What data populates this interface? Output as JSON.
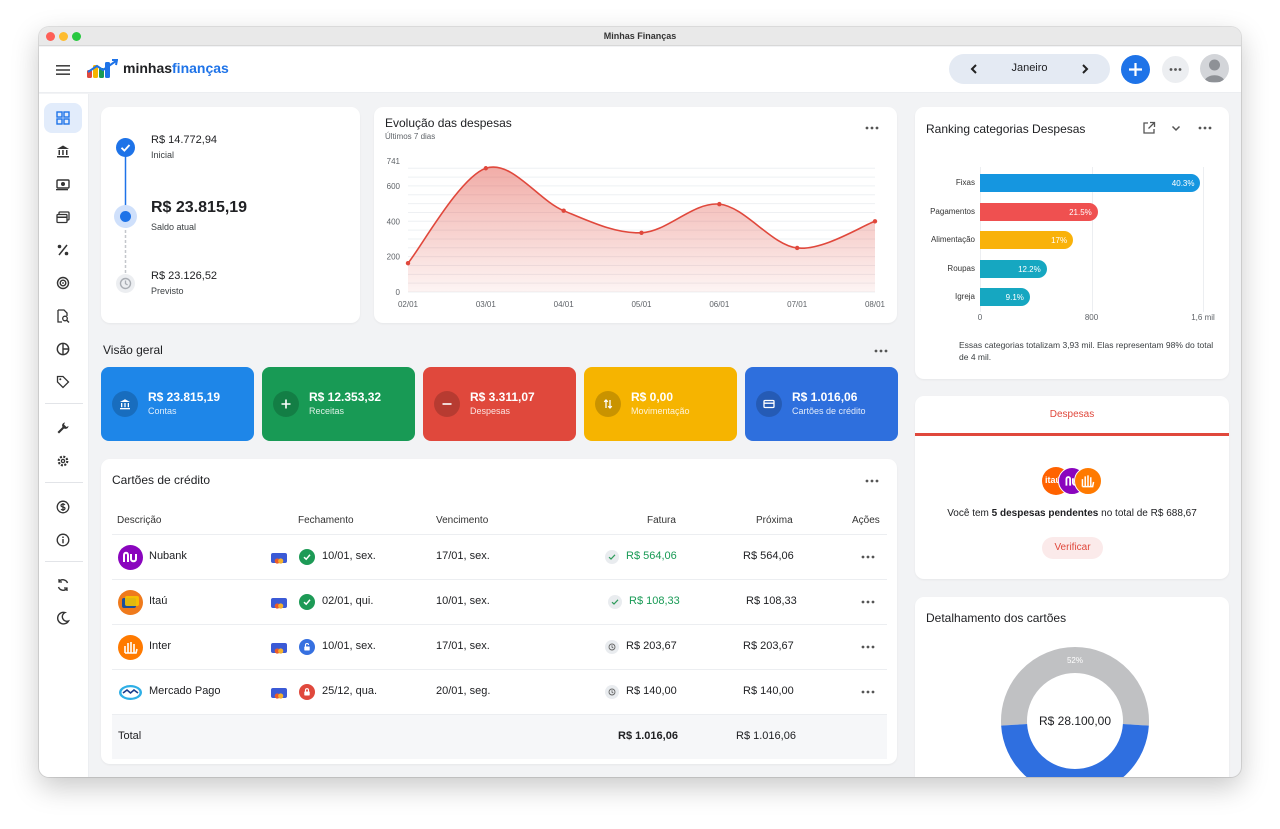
{
  "window": {
    "title": "Minhas Finanças"
  },
  "header": {
    "logo": {
      "part1": "minhas",
      "part2": "finanças"
    },
    "month": "Janeiro"
  },
  "balance": {
    "initial_value": "R$ 14.772,94",
    "initial_label": "Inicial",
    "current_value": "R$ 23.815,19",
    "current_label": "Saldo atual",
    "forecast_value": "R$ 23.126,52",
    "forecast_label": "Previsto"
  },
  "expense_evolution": {
    "title": "Evolução das despesas",
    "subtitle": "Últimos 7 dias"
  },
  "chart_data": [
    {
      "type": "area",
      "title": "Evolução das despesas",
      "subtitle": "Últimos 7 dias",
      "x": [
        "02/01",
        "03/01",
        "04/01",
        "05/01",
        "06/01",
        "07/01",
        "08/01"
      ],
      "y": [
        163,
        700,
        460,
        335,
        497,
        249,
        400
      ],
      "y_ticks": [
        0,
        200,
        400,
        600,
        741
      ],
      "ylim": [
        0,
        741
      ],
      "color": "#e0483c",
      "grid": true
    },
    {
      "type": "bar",
      "orientation": "horizontal",
      "title": "Ranking categorias Despesas",
      "categories": [
        "Fixas",
        "Pagamentos",
        "Alimentação",
        "Roupas",
        "Igreja"
      ],
      "values": [
        1582,
        845,
        668,
        479,
        358
      ],
      "labels": [
        "40.3%",
        "21.5%",
        "17%",
        "12.2%",
        "9.1%"
      ],
      "colors": [
        "#1596e0",
        "#ef5050",
        "#f9b20a",
        "#16a7c1",
        "#16a7c1"
      ],
      "x_ticks": [
        "0",
        "800",
        "1,6 mil"
      ],
      "xlim": [
        0,
        1600
      ]
    },
    {
      "type": "pie",
      "title": "Detalhamento dos cartões",
      "center_label": "R$ 28.100,00",
      "slices": [
        {
          "label": "52%",
          "value": 52,
          "color": "#c0c1c3"
        },
        {
          "label": "48%",
          "value": 48,
          "color": "#2f6fe0"
        }
      ]
    }
  ],
  "overview": {
    "title": "Visão geral",
    "cards": [
      {
        "amount": "R$ 23.815,19",
        "label": "Contas",
        "color": "#1e86e8"
      },
      {
        "amount": "R$ 12.353,32",
        "label": "Receitas",
        "color": "#189a55"
      },
      {
        "amount": "R$ 3.311,07",
        "label": "Despesas",
        "color": "#e0483c"
      },
      {
        "amount": "R$ 0,00",
        "label": "Movimentação",
        "color": "#f6b400"
      },
      {
        "amount": "R$ 1.016,06",
        "label": "Cartões de crédito",
        "color": "#2e6fdd"
      }
    ]
  },
  "cards_table": {
    "title": "Cartões de crédito",
    "headers": {
      "desc": "Descrição",
      "close": "Fechamento",
      "due": "Vencimento",
      "invoice": "Fatura",
      "next": "Próxima",
      "actions": "Ações"
    },
    "rows": [
      {
        "name": "Nubank",
        "closing": "10/01, sex.",
        "due": "17/01, sex.",
        "invoice": "R$ 564,06",
        "next": "R$ 564,06",
        "status": "paid"
      },
      {
        "name": "Itaú",
        "closing": "02/01, qui.",
        "due": "10/01, sex.",
        "invoice": "R$ 108,33",
        "next": "R$ 108,33",
        "status": "paid"
      },
      {
        "name": "Inter",
        "closing": "10/01, sex.",
        "due": "17/01, sex.",
        "invoice": "R$ 203,67",
        "next": "R$ 203,67",
        "status": "open"
      },
      {
        "name": "Mercado Pago",
        "closing": "25/12, qua.",
        "due": "20/01, seg.",
        "invoice": "R$ 140,00",
        "next": "R$ 140,00",
        "status": "closed"
      }
    ],
    "total": {
      "label": "Total",
      "invoice": "R$ 1.016,06",
      "next": "R$ 1.016,06"
    }
  },
  "ranking": {
    "title": "Ranking categorias Despesas",
    "note": "Essas categorias totalizam 3,93 mil. Elas representam 98% do total de 4 mil."
  },
  "pending": {
    "tab": "Despesas",
    "text_pre": "Você tem ",
    "text_bold": "5 despesas pendentes",
    "text_post": " no total de R$ 688,67",
    "button": "Verificar",
    "logo_text": "itaú"
  },
  "card_details": {
    "title": "Detalhamento dos cartões"
  }
}
